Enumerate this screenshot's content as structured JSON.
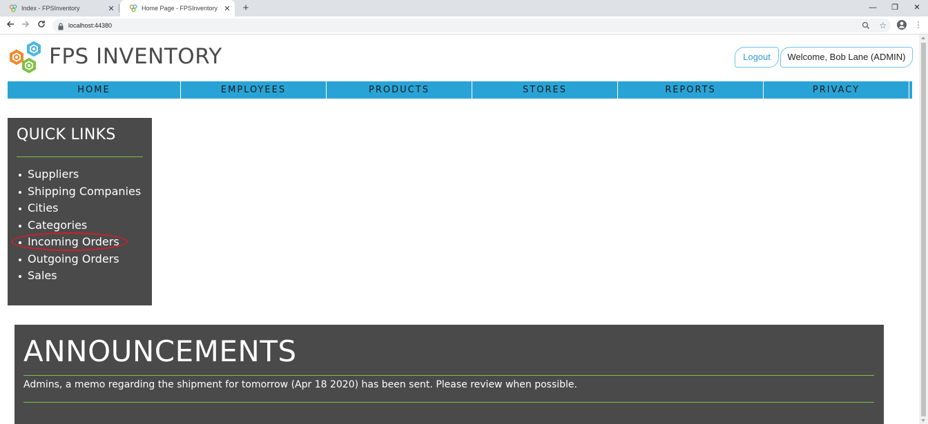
{
  "browser": {
    "tabs": [
      {
        "title": "Index - FPSInventory",
        "active": false
      },
      {
        "title": "Home Page - FPSInventory",
        "active": true
      }
    ],
    "new_tab_label": "+",
    "close_glyph": "✕",
    "window_controls": {
      "minimize": "—",
      "restore": "❐",
      "close": "✕"
    },
    "url": "localhost:44380",
    "icons": {
      "back": "back-arrow-icon",
      "forward": "forward-arrow-icon",
      "reload": "reload-icon",
      "lock": "lock-icon",
      "zoom": "zoom-icon",
      "bookmark": "star-icon",
      "profile": "profile-icon",
      "menu": "kebab-menu-icon"
    }
  },
  "header": {
    "brand": "FPS INVENTORY",
    "logout_label": "Logout",
    "welcome_text": "Welcome, Bob Lane (ADMIN)"
  },
  "nav": {
    "items": [
      {
        "label": "HOME"
      },
      {
        "label": "EMPLOYEES"
      },
      {
        "label": "PRODUCTS"
      },
      {
        "label": "STORES"
      },
      {
        "label": "REPORTS"
      },
      {
        "label": "PRIVACY"
      }
    ]
  },
  "quick_links": {
    "title": "QUICK LINKS",
    "items": [
      {
        "label": "Suppliers"
      },
      {
        "label": "Shipping Companies"
      },
      {
        "label": "Cities"
      },
      {
        "label": "Categories"
      },
      {
        "label": "Incoming Orders",
        "highlighted": true
      },
      {
        "label": "Outgoing Orders"
      },
      {
        "label": "Sales"
      }
    ]
  },
  "announcements": {
    "title": "ANNOUNCEMENTS",
    "message": "Admins, a memo regarding the shipment for tomorrow (Apr 18 2020) has been sent. Please review when possible."
  },
  "colors": {
    "nav_bg": "#29a3d6",
    "panel_bg": "#4a4a4a",
    "accent_green": "#7ec242",
    "highlight_red": "#d11f2a",
    "link_blue": "#2a9ed6"
  }
}
